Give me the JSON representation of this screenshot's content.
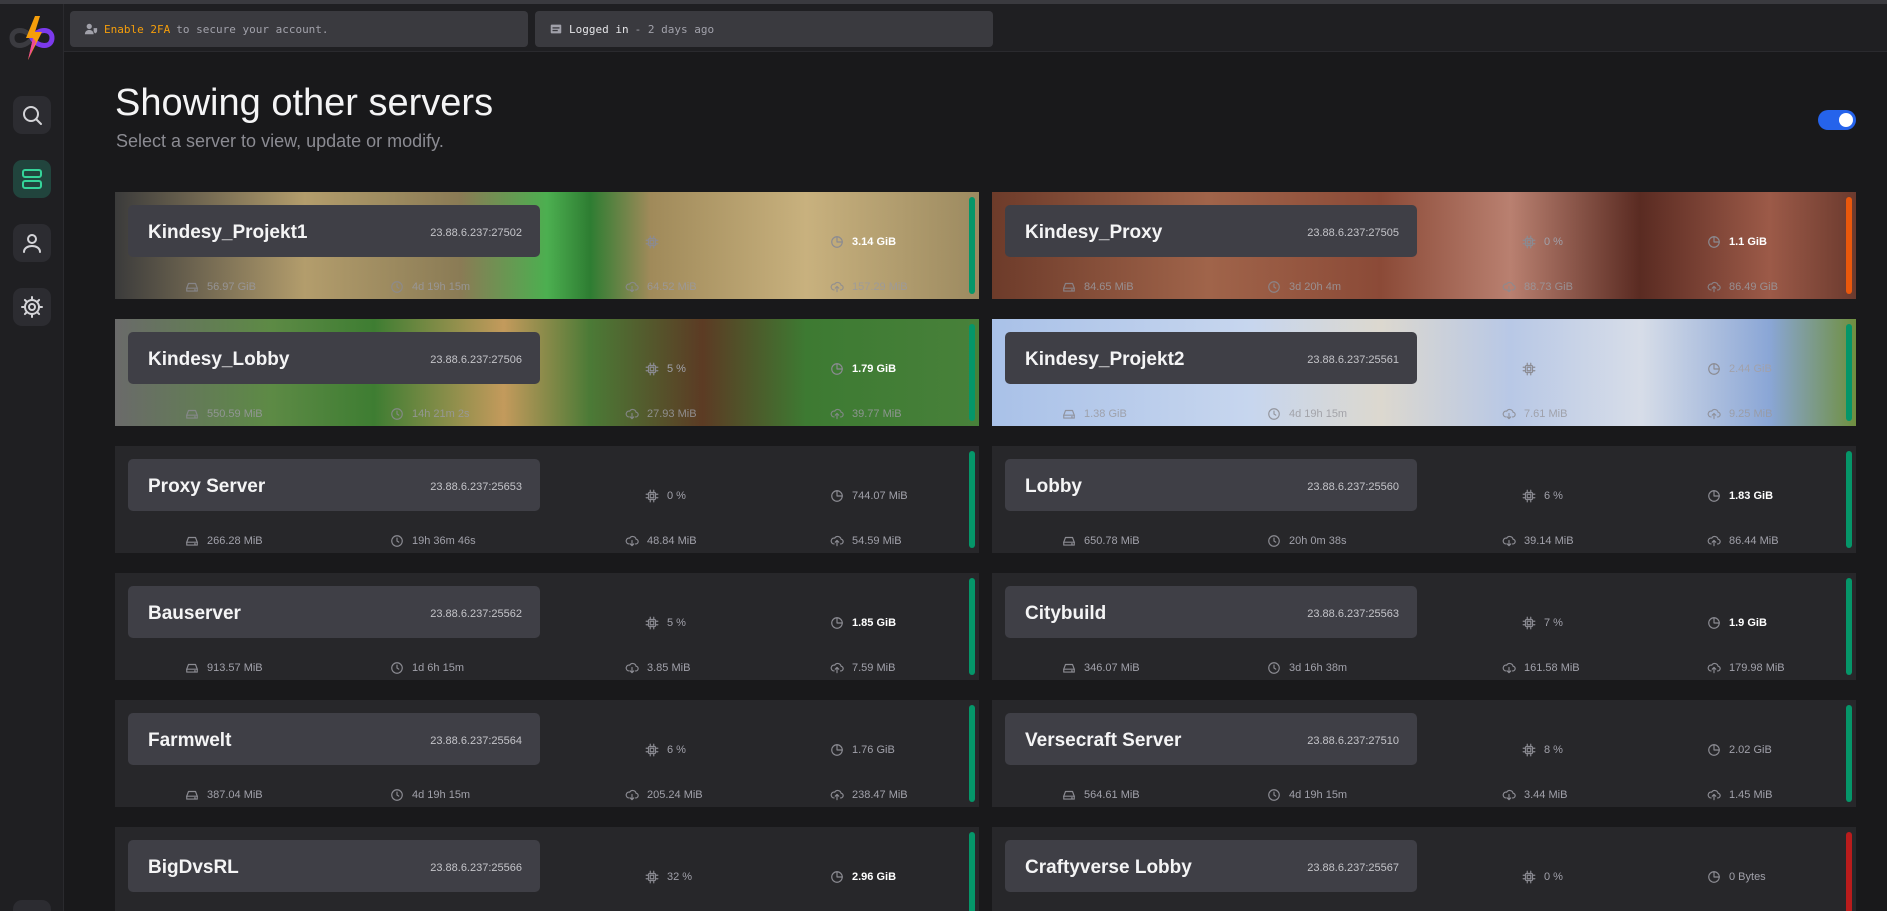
{
  "topbar": {
    "twofa": {
      "accent": "Enable 2FA",
      "text": "to secure your account."
    },
    "login": {
      "strong": "Logged in",
      "text": "- 2 days ago"
    }
  },
  "header": {
    "title": "Showing other servers",
    "subtitle": "Select a server to view, update or modify."
  },
  "show_all_toggle": {
    "on": true
  },
  "colors": {
    "accent_green": "#34d399",
    "status_online": "#059669",
    "status_starting": "#ea580c",
    "status_offline": "#b91c1c",
    "toggle_blue": "#2563eb",
    "warning_orange": "#f59e0b"
  },
  "servers": [
    {
      "name": "Kindesy_Projekt1",
      "address": "23.88.6.237:27502",
      "cpu": "",
      "memory": "3.14 GiB",
      "disk": "56.97 GiB",
      "uptime": "4d 19h 15m",
      "download": "64.52 MiB",
      "upload": "157.29 MiB",
      "status": "online",
      "background": "minecraft-creeper"
    },
    {
      "name": "Kindesy_Proxy",
      "address": "23.88.6.237:27505",
      "cpu": "0 %",
      "memory": "1.1 GiB",
      "disk": "84.65 MiB",
      "uptime": "3d 20h 4m",
      "download": "88.73 GiB",
      "upload": "86.49 GiB",
      "status": "starting",
      "background": "minecraft-brown"
    },
    {
      "name": "Kindesy_Lobby",
      "address": "23.88.6.237:27506",
      "cpu": "5 %",
      "memory": "1.79 GiB",
      "disk": "550.59 MiB",
      "uptime": "14h 21m 2s",
      "download": "27.93 MiB",
      "upload": "39.77 MiB",
      "status": "online",
      "background": "minecraft-grass"
    },
    {
      "name": "Kindesy_Projekt2",
      "address": "23.88.6.237:25561",
      "cpu": "",
      "memory": "2.44 GiB",
      "disk": "1.38 GiB",
      "uptime": "4d 19h 15m",
      "download": "7.61 MiB",
      "upload": "9.25 MiB",
      "status": "online",
      "background": "minecraft-sky"
    },
    {
      "name": "Proxy Server",
      "address": "23.88.6.237:25653",
      "cpu": "0 %",
      "memory": "744.07 MiB",
      "disk": "266.28 MiB",
      "uptime": "19h 36m 46s",
      "download": "48.84 MiB",
      "upload": "54.59 MiB",
      "status": "online"
    },
    {
      "name": "Lobby",
      "address": "23.88.6.237:25560",
      "cpu": "6 %",
      "memory": "1.83 GiB",
      "disk": "650.78 MiB",
      "uptime": "20h 0m 38s",
      "download": "39.14 MiB",
      "upload": "86.44 MiB",
      "status": "online"
    },
    {
      "name": "Bauserver",
      "address": "23.88.6.237:25562",
      "cpu": "5 %",
      "memory": "1.85 GiB",
      "disk": "913.57 MiB",
      "uptime": "1d 6h 15m",
      "download": "3.85 MiB",
      "upload": "7.59 MiB",
      "status": "online"
    },
    {
      "name": "Citybuild",
      "address": "23.88.6.237:25563",
      "cpu": "7 %",
      "memory": "1.9 GiB",
      "disk": "346.07 MiB",
      "uptime": "3d 16h 38m",
      "download": "161.58 MiB",
      "upload": "179.98 MiB",
      "status": "online"
    },
    {
      "name": "Farmwelt",
      "address": "23.88.6.237:25564",
      "cpu": "6 %",
      "memory": "1.76 GiB",
      "disk": "387.04 MiB",
      "uptime": "4d 19h 15m",
      "download": "205.24 MiB",
      "upload": "238.47 MiB",
      "status": "online"
    },
    {
      "name": "Versecraft Server",
      "address": "23.88.6.237:27510",
      "cpu": "8 %",
      "memory": "2.02 GiB",
      "disk": "564.61 MiB",
      "uptime": "4d 19h 15m",
      "download": "3.44 MiB",
      "upload": "1.45 MiB",
      "status": "online"
    },
    {
      "name": "BigDvsRL",
      "address": "23.88.6.237:25566",
      "cpu": "32 %",
      "memory": "2.96 GiB",
      "status": "online"
    },
    {
      "name": "Craftyverse Lobby",
      "address": "23.88.6.237:25567",
      "cpu": "0 %",
      "memory": "0 Bytes",
      "status": "offline"
    }
  ]
}
